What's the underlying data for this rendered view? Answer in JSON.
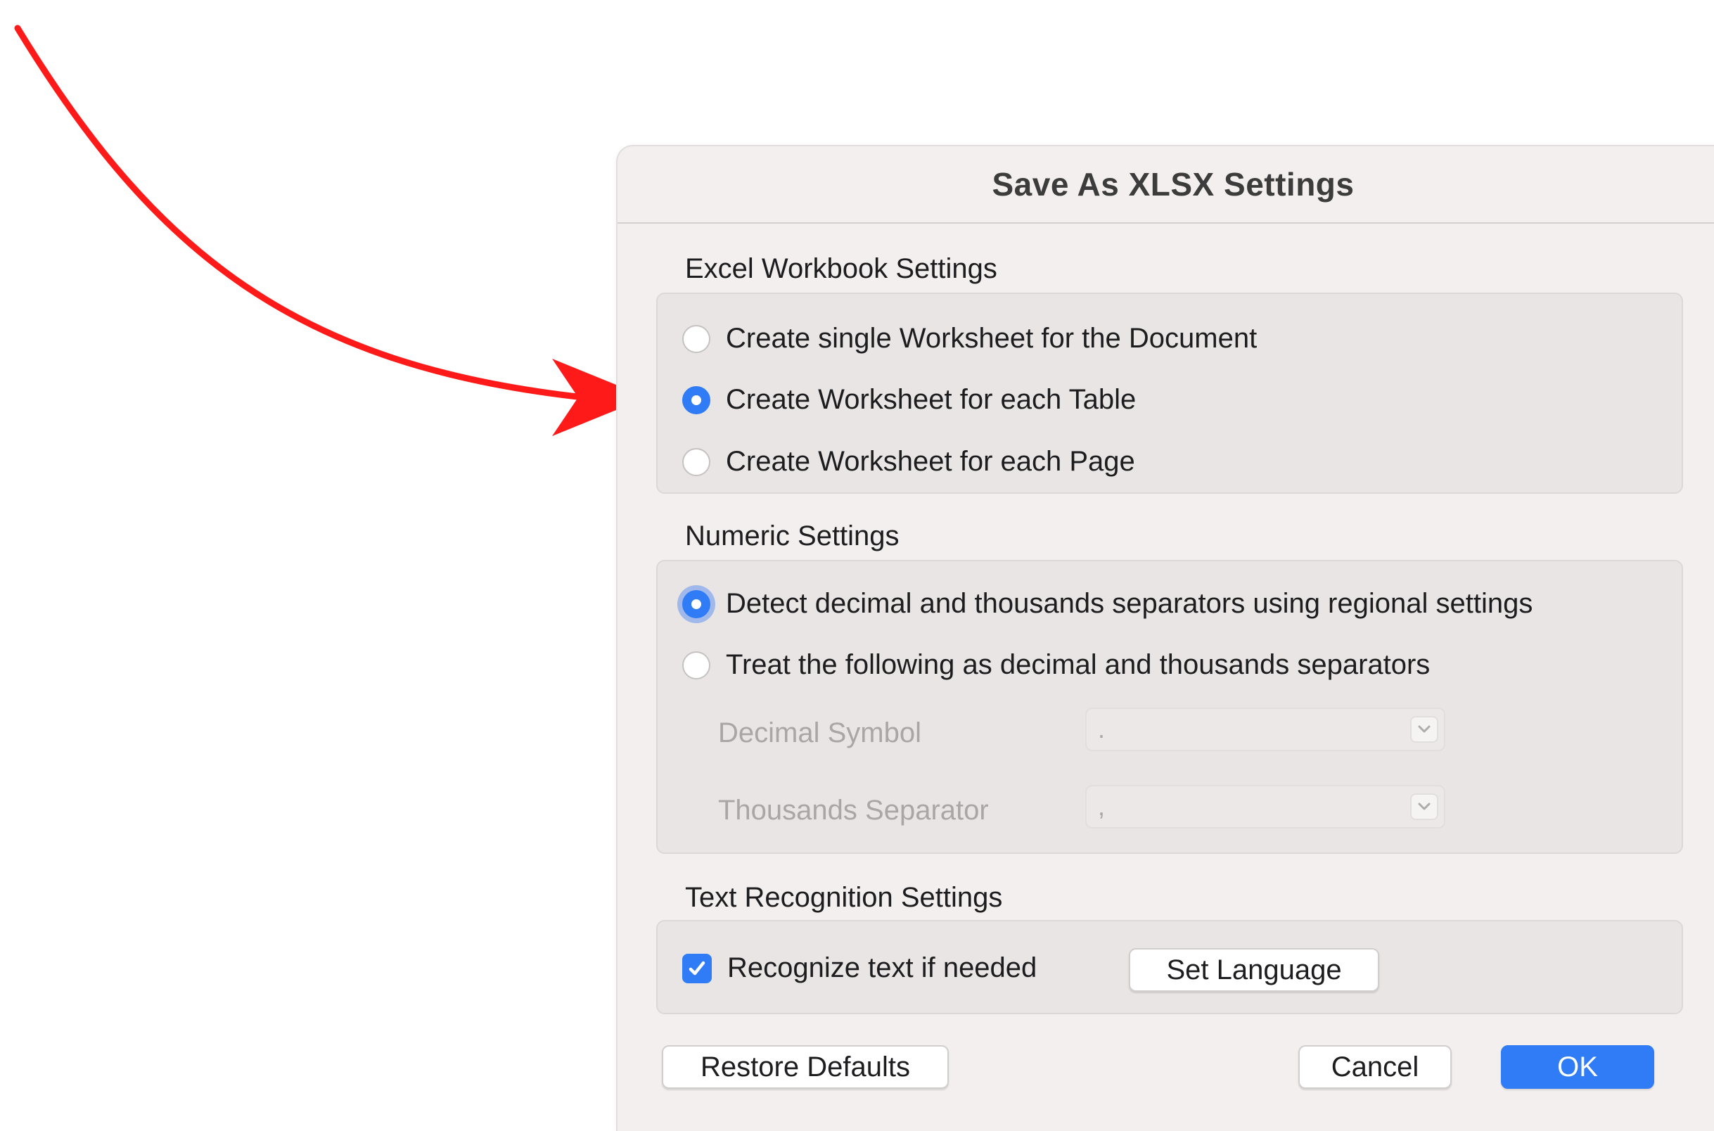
{
  "dialog": {
    "title": "Save As XLSX Settings"
  },
  "workbook": {
    "label": "Excel Workbook Settings",
    "options": [
      {
        "label": "Create single Worksheet for the Document",
        "selected": false
      },
      {
        "label": "Create Worksheet for each Table",
        "selected": true
      },
      {
        "label": "Create Worksheet for each Page",
        "selected": false
      }
    ]
  },
  "numeric": {
    "label": "Numeric Settings",
    "options": [
      {
        "label": "Detect decimal and thousands separators using regional settings",
        "selected": true
      },
      {
        "label": "Treat the following as decimal and thousands separators",
        "selected": false
      }
    ],
    "decimal_label": "Decimal Symbol",
    "decimal_value": ".",
    "thousands_label": "Thousands Separator",
    "thousands_value": ","
  },
  "ocr": {
    "label": "Text Recognition Settings",
    "checkbox_label": "Recognize text if needed",
    "checked": true,
    "language_button": "Set Language"
  },
  "footer": {
    "restore_label": "Restore Defaults",
    "cancel_label": "Cancel",
    "ok_label": "OK"
  },
  "colors": {
    "accent": "#2f7cf6",
    "annotation_arrow": "#ff1a1a"
  }
}
